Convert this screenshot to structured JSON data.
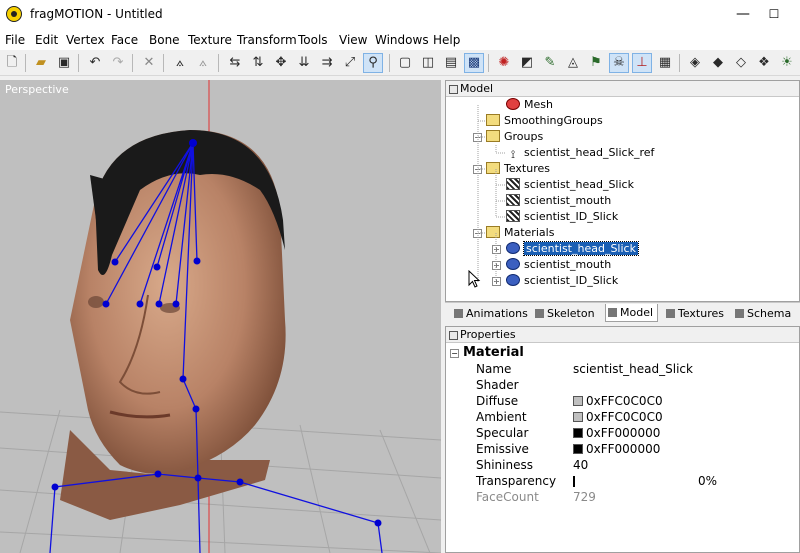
{
  "window": {
    "title": "fragMOTION - Untitled",
    "minimize": "—",
    "maximize": "☐",
    "close": "✕"
  },
  "menu": [
    "File",
    "Edit",
    "Vertex",
    "Face",
    "Bone",
    "Texture",
    "Transform",
    "Tools",
    "View",
    "Windows",
    "Help"
  ],
  "viewport": {
    "label": "Perspective"
  },
  "model_panel": {
    "title": "Model",
    "tree": [
      {
        "label": "Mesh",
        "icon": "mesh-icon"
      },
      {
        "label": "SmoothingGroups",
        "icon": "folder-icon"
      },
      {
        "label": "Groups",
        "icon": "folder-icon"
      },
      {
        "label": "scientist_head_Slick_ref",
        "icon": "bone-icon"
      },
      {
        "label": "Textures",
        "icon": "folder-icon"
      },
      {
        "label": "scientist_head_Slick",
        "icon": "texture-icon"
      },
      {
        "label": "scientist_mouth",
        "icon": "texture-icon"
      },
      {
        "label": "scientist_ID_Slick",
        "icon": "texture-icon"
      },
      {
        "label": "Materials",
        "icon": "folder-icon"
      },
      {
        "label": "scientist_head_Slick",
        "icon": "material-icon",
        "selected": true
      },
      {
        "label": "scientist_mouth",
        "icon": "material-icon"
      },
      {
        "label": "scientist_ID_Slick",
        "icon": "material-icon"
      }
    ]
  },
  "tabs": [
    {
      "label": "Animations"
    },
    {
      "label": "Skeleton"
    },
    {
      "label": "Model",
      "active": true
    },
    {
      "label": "Textures"
    },
    {
      "label": "Schema"
    }
  ],
  "properties": {
    "title": "Properties",
    "category": "Material",
    "rows": [
      {
        "name": "Name",
        "value": "scientist_head_Slick"
      },
      {
        "name": "Shader",
        "value": ""
      },
      {
        "name": "Diffuse",
        "value": "0xFFC0C0C0",
        "color": "#c0c0c0"
      },
      {
        "name": "Ambient",
        "value": "0xFFC0C0C0",
        "color": "#c0c0c0"
      },
      {
        "name": "Specular",
        "value": "0xFF000000",
        "color": "#000000"
      },
      {
        "name": "Emissive",
        "value": "0xFF000000",
        "color": "#000000"
      },
      {
        "name": "Shininess",
        "value": "40"
      },
      {
        "name": "Transparency",
        "value": "0%"
      },
      {
        "name": "FaceCount",
        "value": "729",
        "disabled": true
      }
    ]
  }
}
